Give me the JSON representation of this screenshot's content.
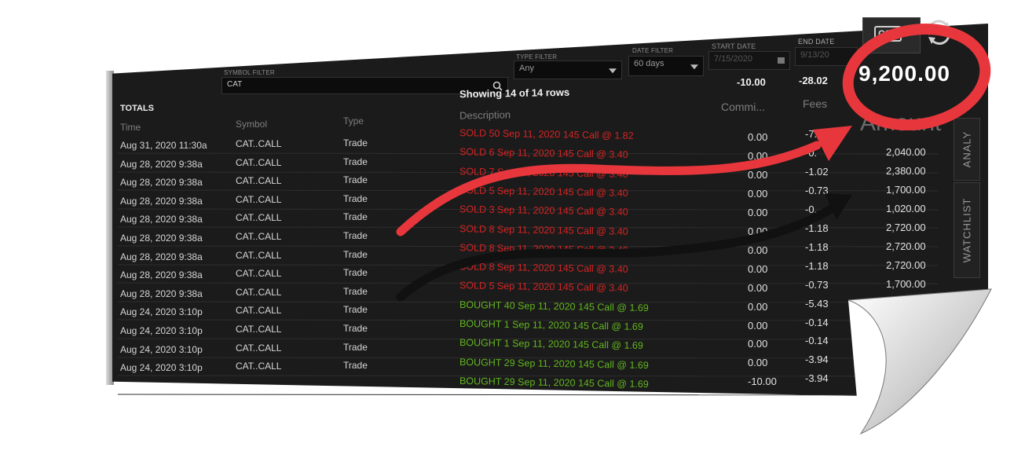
{
  "filters": {
    "symbol": {
      "label": "SYMBOL FILTER",
      "value": "CAT"
    },
    "type": {
      "label": "TYPE FILTER",
      "value": "Any"
    },
    "date": {
      "label": "DATE FILTER",
      "value": "60 days"
    },
    "start": {
      "label": "START DATE",
      "value": "7/15/2020"
    },
    "end": {
      "label": "END DATE",
      "value": "9/13/20"
    }
  },
  "toolbar": {
    "csv_label": "CSV",
    "refresh_icon": "refresh-icon"
  },
  "totals": {
    "label": "TOTALS",
    "showing": "Showing 14 of 14 rows",
    "commission": "-10.00",
    "fees": "-28.02",
    "amount": "9,200.00"
  },
  "columns": {
    "time": "Time",
    "symbol": "Symbol",
    "type": "Type",
    "description": "Description",
    "commission": "Commi...",
    "fees": "Fees",
    "amount": "Amount"
  },
  "rows": [
    {
      "time": "Aug 31, 2020  11:30a",
      "symbol": "CAT..CALL",
      "type": "Trade",
      "description": "SOLD 50 Sep 11, 2020 145 Call @ 1.82",
      "side": "sold",
      "commission": "0.00",
      "fees": "-7.10",
      "amount": ""
    },
    {
      "time": "Aug 28, 2020  9:38a",
      "symbol": "CAT..CALL",
      "type": "Trade",
      "description": "SOLD 6 Sep 11, 2020 145 Call @ 3.40",
      "side": "sold",
      "commission": "0.00",
      "fees": "-0.",
      "amount": "2,040.00"
    },
    {
      "time": "Aug 28, 2020  9:38a",
      "symbol": "CAT..CALL",
      "type": "Trade",
      "description": "SOLD 7 Sep 11, 2020 145 Call @ 3.40",
      "side": "sold",
      "commission": "0.00",
      "fees": "-1.02",
      "amount": "2,380.00"
    },
    {
      "time": "Aug 28, 2020  9:38a",
      "symbol": "CAT..CALL",
      "type": "Trade",
      "description": "SOLD 5 Sep 11, 2020 145 Call @ 3.40",
      "side": "sold",
      "commission": "0.00",
      "fees": "-0.73",
      "amount": "1,700.00"
    },
    {
      "time": "Aug 28, 2020  9:38a",
      "symbol": "CAT..CALL",
      "type": "Trade",
      "description": "SOLD 3 Sep 11, 2020 145 Call @ 3.40",
      "side": "sold",
      "commission": "0.00",
      "fees": "-0.",
      "amount": "1,020.00"
    },
    {
      "time": "Aug 28, 2020  9:38a",
      "symbol": "CAT..CALL",
      "type": "Trade",
      "description": "SOLD 8 Sep 11, 2020 145 Call @ 3.40",
      "side": "sold",
      "commission": "0.00",
      "fees": "-1.18",
      "amount": "2,720.00"
    },
    {
      "time": "Aug 28, 2020  9:38a",
      "symbol": "CAT..CALL",
      "type": "Trade",
      "description": "SOLD 8 Sep 11, 2020 145 Call @ 3.40",
      "side": "sold",
      "commission": "0.00",
      "fees": "-1.18",
      "amount": "2,720.00"
    },
    {
      "time": "Aug 28, 2020  9:38a",
      "symbol": "CAT..CALL",
      "type": "Trade",
      "description": "SOLD 8 Sep 11, 2020 145 Call @ 3.40",
      "side": "sold",
      "commission": "0.00",
      "fees": "-1.18",
      "amount": "2,720.00"
    },
    {
      "time": "Aug 28, 2020  9:38a",
      "symbol": "CAT..CALL",
      "type": "Trade",
      "description": "SOLD 5 Sep 11, 2020 145 Call @ 3.40",
      "side": "sold",
      "commission": "0.00",
      "fees": "-0.73",
      "amount": "1,700.00"
    },
    {
      "time": "Aug 24, 2020  3:10p",
      "symbol": "CAT..CALL",
      "type": "Trade",
      "description": "BOUGHT 40 Sep 11, 2020 145 Call @ 1.69",
      "side": "bought",
      "commission": "0.00",
      "fees": "-5.43",
      "amount": ""
    },
    {
      "time": "Aug 24, 2020  3:10p",
      "symbol": "CAT..CALL",
      "type": "Trade",
      "description": "BOUGHT 1 Sep 11, 2020 145 Call @ 1.69",
      "side": "bought",
      "commission": "0.00",
      "fees": "-0.14",
      "amount": ""
    },
    {
      "time": "Aug 24, 2020  3:10p",
      "symbol": "CAT..CALL",
      "type": "Trade",
      "description": "BOUGHT 1 Sep 11, 2020 145 Call @ 1.69",
      "side": "bought",
      "commission": "0.00",
      "fees": "-0.14",
      "amount": ""
    },
    {
      "time": "Aug 24, 2020  3:10p",
      "symbol": "CAT..CALL",
      "type": "Trade",
      "description": "BOUGHT 29 Sep 11, 2020 145 Call @ 1.69",
      "side": "bought",
      "commission": "0.00",
      "fees": "-3.94",
      "amount": ""
    },
    {
      "time": "",
      "symbol": "",
      "type": "",
      "description": "BOUGHT 29 Sep 11, 2020 145 Call @ 1.69",
      "side": "bought",
      "commission": "-10.00",
      "fees": "-3.94",
      "amount": ""
    }
  ],
  "sidetabs": [
    "ANALY",
    "WATCHLIST"
  ],
  "colors": {
    "sold": "#d42424",
    "bought": "#62b51f",
    "highlight": "#e8373c"
  }
}
